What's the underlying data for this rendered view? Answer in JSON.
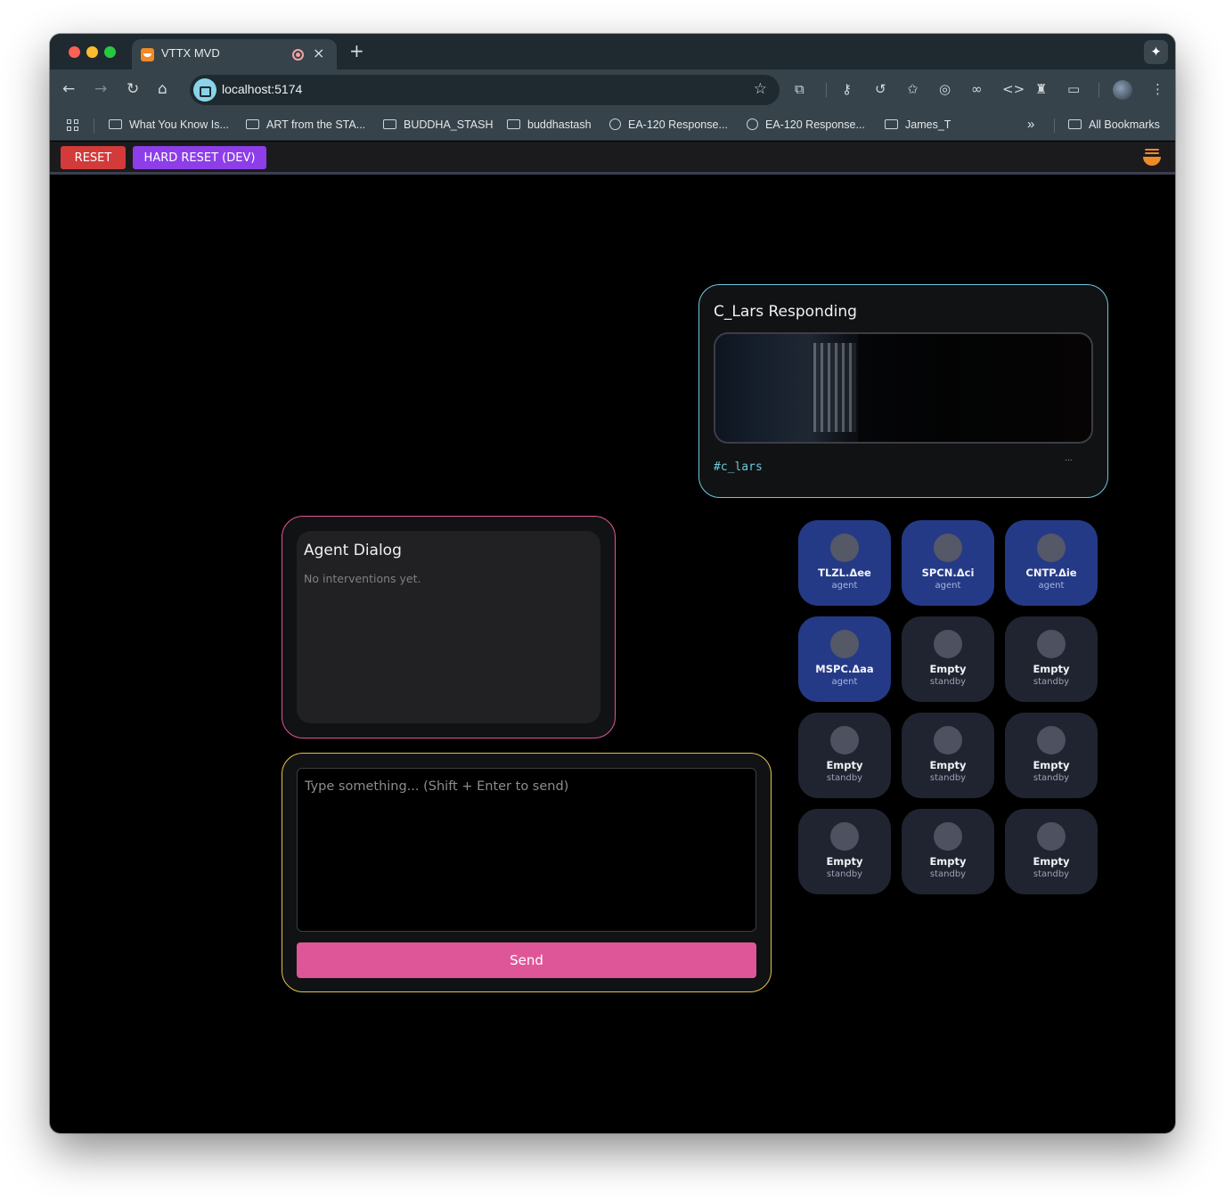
{
  "browser": {
    "tab_title": "VTTX MVD",
    "tab_close": "×",
    "new_tab": "+",
    "url": "localhost:5174",
    "bookmarks": [
      {
        "label": "What You Know Is...",
        "icon": "folder-icon"
      },
      {
        "label": "ART from the STA...",
        "icon": "folder-icon"
      },
      {
        "label": "BUDDHA_STASH",
        "icon": "folder-icon"
      },
      {
        "label": "buddhastash",
        "icon": "folder-icon"
      },
      {
        "label": "EA-120 Response...",
        "icon": "globe-icon"
      },
      {
        "label": "EA-120 Response...",
        "icon": "globe-icon"
      },
      {
        "label": "James_T",
        "icon": "folder-icon"
      }
    ],
    "bookmarks_overflow": "»",
    "all_bookmarks": "All Bookmarks"
  },
  "appbar": {
    "reset_label": "RESET",
    "hard_reset_label": "HARD RESET (DEV)"
  },
  "responding": {
    "title": "C_Lars Responding",
    "tag": "#c_lars",
    "ellipsis": "..."
  },
  "dialog": {
    "title": "Agent Dialog",
    "empty_text": "No interventions yet."
  },
  "composer": {
    "placeholder": "Type something... (Shift + Enter to send)",
    "value": "",
    "send_label": "Send"
  },
  "agents": [
    {
      "name": "TLZL.Δee",
      "role": "agent",
      "active": true
    },
    {
      "name": "SPCN.Δci",
      "role": "agent",
      "active": true
    },
    {
      "name": "CNTP.Δie",
      "role": "agent",
      "active": true
    },
    {
      "name": "MSPC.Δaa",
      "role": "agent",
      "active": true
    },
    {
      "name": "Empty",
      "role": "standby",
      "active": false
    },
    {
      "name": "Empty",
      "role": "standby",
      "active": false
    },
    {
      "name": "Empty",
      "role": "standby",
      "active": false
    },
    {
      "name": "Empty",
      "role": "standby",
      "active": false
    },
    {
      "name": "Empty",
      "role": "standby",
      "active": false
    },
    {
      "name": "Empty",
      "role": "standby",
      "active": false
    },
    {
      "name": "Empty",
      "role": "standby",
      "active": false
    },
    {
      "name": "Empty",
      "role": "standby",
      "active": false
    }
  ],
  "colors": {
    "reset": "#d33a3a",
    "hard_reset": "#8d3ee8",
    "responding_border": "#6fc8d8",
    "dialog_border": "#e0579a",
    "composer_border": "#e6c14d",
    "send": "#df5698",
    "agent_active": "#253a86",
    "agent_standby": "#202430"
  }
}
